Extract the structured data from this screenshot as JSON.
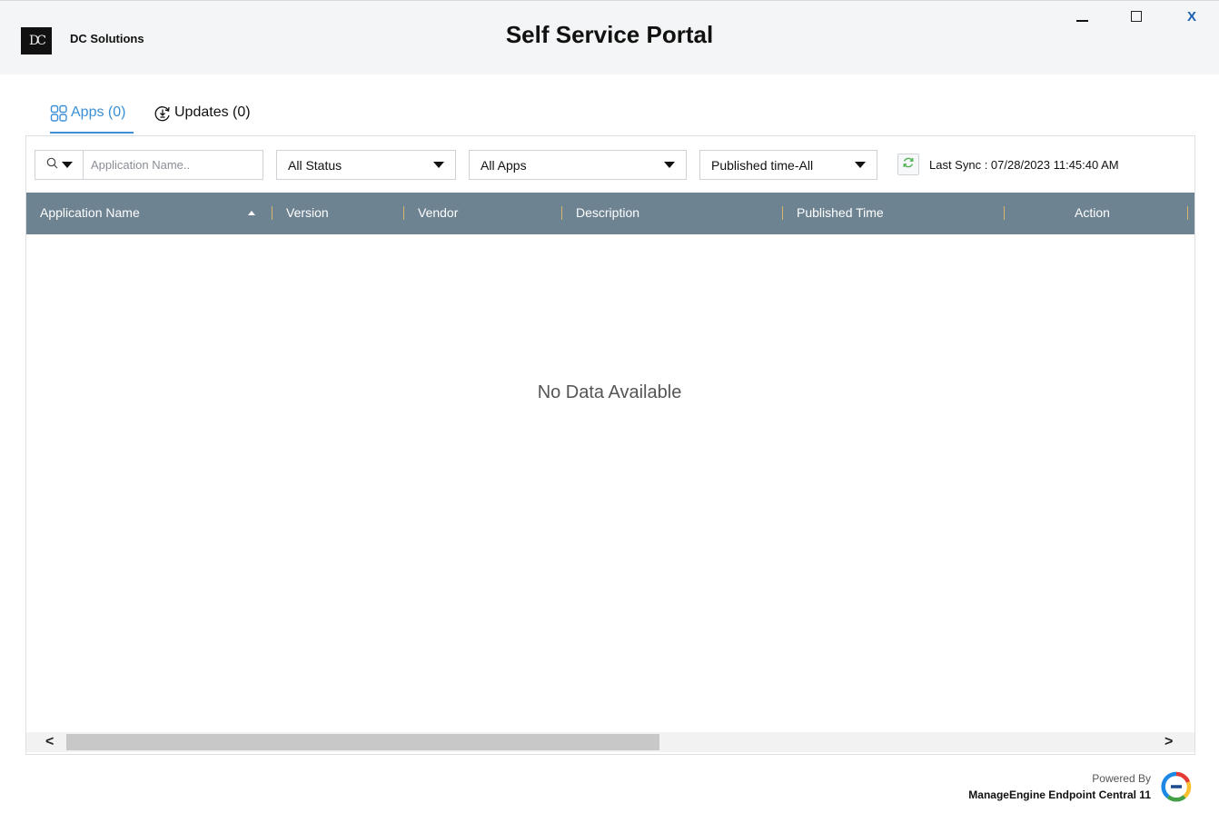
{
  "window": {
    "company_name": "DC Solutions",
    "logo_text": "DC",
    "title": "Self Service Portal",
    "controls": {
      "minimize": "minimize-icon",
      "maximize": "maximize-icon",
      "close": "X"
    }
  },
  "tabs": [
    {
      "label": "Apps (0)",
      "icon": "apps-grid-icon",
      "active": true
    },
    {
      "label": "Updates (0)",
      "icon": "updates-icon",
      "active": false
    }
  ],
  "filters": {
    "search_icon": "search-icon",
    "search_placeholder": "Application Name..",
    "search_value": "",
    "status": "All Status",
    "apps": "All Apps",
    "published": "Published time-All",
    "sync_icon": "refresh-icon",
    "last_sync": "Last Sync : 07/28/2023 11:45:40 AM"
  },
  "table": {
    "columns": [
      "Application Name",
      "Version",
      "Vendor",
      "Description",
      "Published Time",
      "Action"
    ],
    "sort": {
      "column": "Application Name",
      "direction": "ascending"
    },
    "rows": [],
    "empty_message": "No Data Available"
  },
  "scrollbar": {
    "left_arrow": "<",
    "right_arrow": ">"
  },
  "footer": {
    "powered_by": "Powered By",
    "product": "ManageEngine Endpoint Central 11",
    "logo_icon": "manageengine-logo-icon"
  },
  "colors": {
    "accent": "#3b8fd6",
    "header_bg": "#6e8391",
    "titlebar_bg": "#f4f5f6",
    "close_button": "#1a5fb4"
  }
}
